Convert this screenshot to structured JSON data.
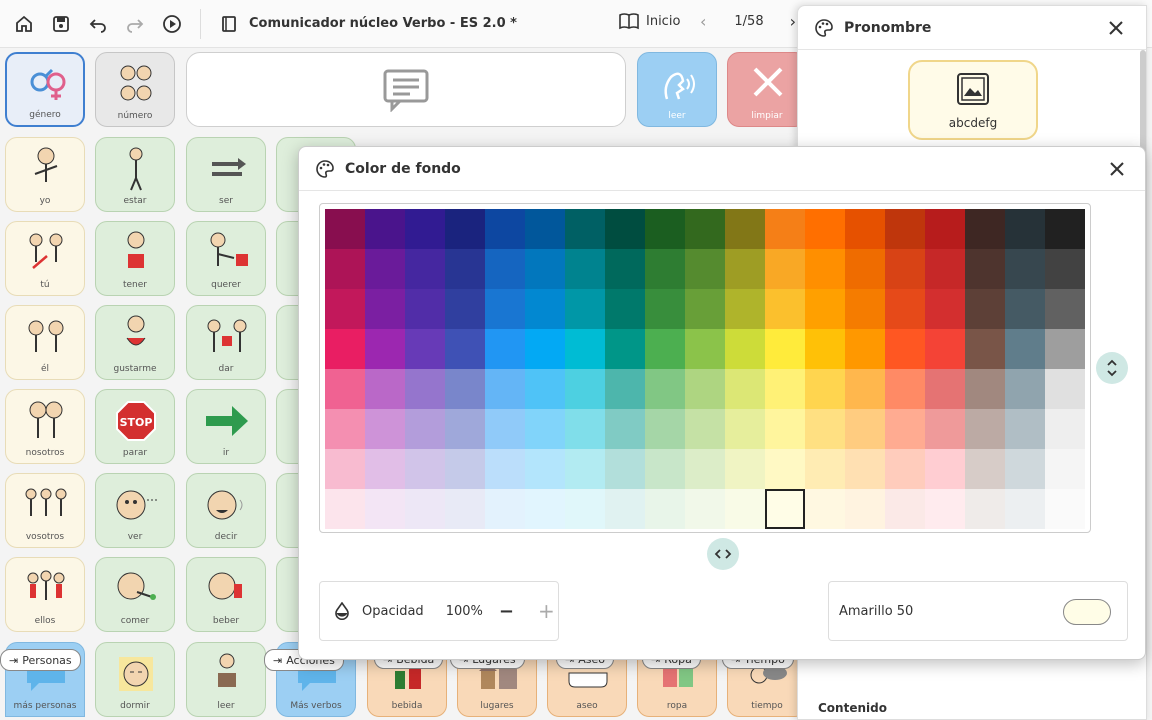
{
  "toolbar": {
    "title": "Comunicador núcleo Verbo - ES 2.0 *",
    "home_label": "Inicio",
    "page": "1/58"
  },
  "grid": {
    "top": [
      {
        "label": "género",
        "color": "gray"
      },
      {
        "label": "número",
        "color": "gray"
      },
      {
        "label": "leer",
        "color": "blue"
      },
      {
        "label": "limpiar",
        "color": "red"
      }
    ],
    "col1": [
      {
        "label": "yo"
      },
      {
        "label": "tú"
      },
      {
        "label": "él"
      },
      {
        "label": "nosotros"
      },
      {
        "label": "vosotros"
      },
      {
        "label": "ellos"
      },
      {
        "label": "más personas"
      }
    ],
    "col2": [
      {
        "label": "estar"
      },
      {
        "label": "tener"
      },
      {
        "label": "gustarme"
      },
      {
        "label": "parar"
      },
      {
        "label": "ver"
      },
      {
        "label": "comer"
      },
      {
        "label": "dormir"
      }
    ],
    "col3": [
      {
        "label": "ser"
      },
      {
        "label": "querer"
      },
      {
        "label": "dar"
      },
      {
        "label": "ir"
      },
      {
        "label": "decir"
      },
      {
        "label": "beber"
      },
      {
        "label": "leer"
      }
    ],
    "bottom": [
      {
        "label": "Más verbos",
        "folder": "Acciones"
      },
      {
        "label": "bebida",
        "folder": "Bebida"
      },
      {
        "label": "lugares",
        "folder": "Lugares"
      },
      {
        "label": "aseo",
        "folder": "Aseo"
      },
      {
        "label": "ropa",
        "folder": "Ropa"
      },
      {
        "label": "tiempo",
        "folder": "Tiempo"
      }
    ],
    "personas_folder": "Personas"
  },
  "sidepanel": {
    "title": "Pronombre",
    "preview_text": "abcdefg",
    "section": "Contenido"
  },
  "color_dialog": {
    "title": "Color de fondo",
    "opacity_label": "Opacidad",
    "opacity_value": "100%",
    "selected_color_name": "Amarillo 50",
    "selected_color": "#fffde7",
    "palette": [
      [
        "#880e4f",
        "#4a148c",
        "#311b92",
        "#1a237e",
        "#0d47a1",
        "#01579b",
        "#006064",
        "#004d40",
        "#1b5e20",
        "#33691e",
        "#827717",
        "#f57f17",
        "#ff6f00",
        "#e65100",
        "#bf360c",
        "#b71c1c",
        "#3e2723",
        "#263238",
        "#212121"
      ],
      [
        "#ad1457",
        "#6a1b9a",
        "#4527a0",
        "#283593",
        "#1565c0",
        "#0277bd",
        "#00838f",
        "#00695c",
        "#2e7d32",
        "#558b2f",
        "#9e9d24",
        "#f9a825",
        "#ff8f00",
        "#ef6c00",
        "#d84315",
        "#c62828",
        "#4e342e",
        "#37474f",
        "#424242"
      ],
      [
        "#c2185b",
        "#7b1fa2",
        "#512da8",
        "#303f9f",
        "#1976d2",
        "#0288d1",
        "#0097a7",
        "#00796b",
        "#388e3c",
        "#689f38",
        "#afb42b",
        "#fbc02d",
        "#ffa000",
        "#f57c00",
        "#e64a19",
        "#d32f2f",
        "#5d4037",
        "#455a64",
        "#616161"
      ],
      [
        "#e91e63",
        "#9c27b0",
        "#673ab7",
        "#3f51b5",
        "#2196f3",
        "#03a9f4",
        "#00bcd4",
        "#009688",
        "#4caf50",
        "#8bc34a",
        "#cddc39",
        "#ffeb3b",
        "#ffc107",
        "#ff9800",
        "#ff5722",
        "#f44336",
        "#795548",
        "#607d8b",
        "#9e9e9e"
      ],
      [
        "#f06292",
        "#ba68c8",
        "#9575cd",
        "#7986cb",
        "#64b5f6",
        "#4fc3f7",
        "#4dd0e1",
        "#4db6ac",
        "#81c784",
        "#aed581",
        "#dce775",
        "#fff176",
        "#ffd54f",
        "#ffb74d",
        "#ff8a65",
        "#e57373",
        "#a1887f",
        "#90a4ae",
        "#e0e0e0"
      ],
      [
        "#f48fb1",
        "#ce93d8",
        "#b39ddb",
        "#9fa8da",
        "#90caf9",
        "#81d4fa",
        "#80deea",
        "#80cbc4",
        "#a5d6a7",
        "#c5e1a5",
        "#e6ee9c",
        "#fff59d",
        "#ffe082",
        "#ffcc80",
        "#ffab91",
        "#ef9a9a",
        "#bcaaa4",
        "#b0bec5",
        "#eeeeee"
      ],
      [
        "#f8bbd0",
        "#e1bee7",
        "#d1c4e9",
        "#c5cae9",
        "#bbdefb",
        "#b3e5fc",
        "#b2ebf2",
        "#b2dfdb",
        "#c8e6c9",
        "#dcedc8",
        "#f0f4c3",
        "#fff9c4",
        "#ffecb3",
        "#ffe0b2",
        "#ffccbc",
        "#ffcdd2",
        "#d7ccc8",
        "#cfd8dc",
        "#f5f5f5"
      ],
      [
        "#fce4ec",
        "#f3e5f5",
        "#ede7f6",
        "#e8eaf6",
        "#e3f2fd",
        "#e1f5fe",
        "#e0f7fa",
        "#e0f2f1",
        "#e8f5e9",
        "#f1f8e9",
        "#f9fbe7",
        "#fffde7",
        "#fff8e1",
        "#fff3e0",
        "#fbe9e7",
        "#ffebee",
        "#efebe9",
        "#eceff1",
        "#fafafa"
      ]
    ],
    "selected_row": 7,
    "selected_col": 11
  }
}
